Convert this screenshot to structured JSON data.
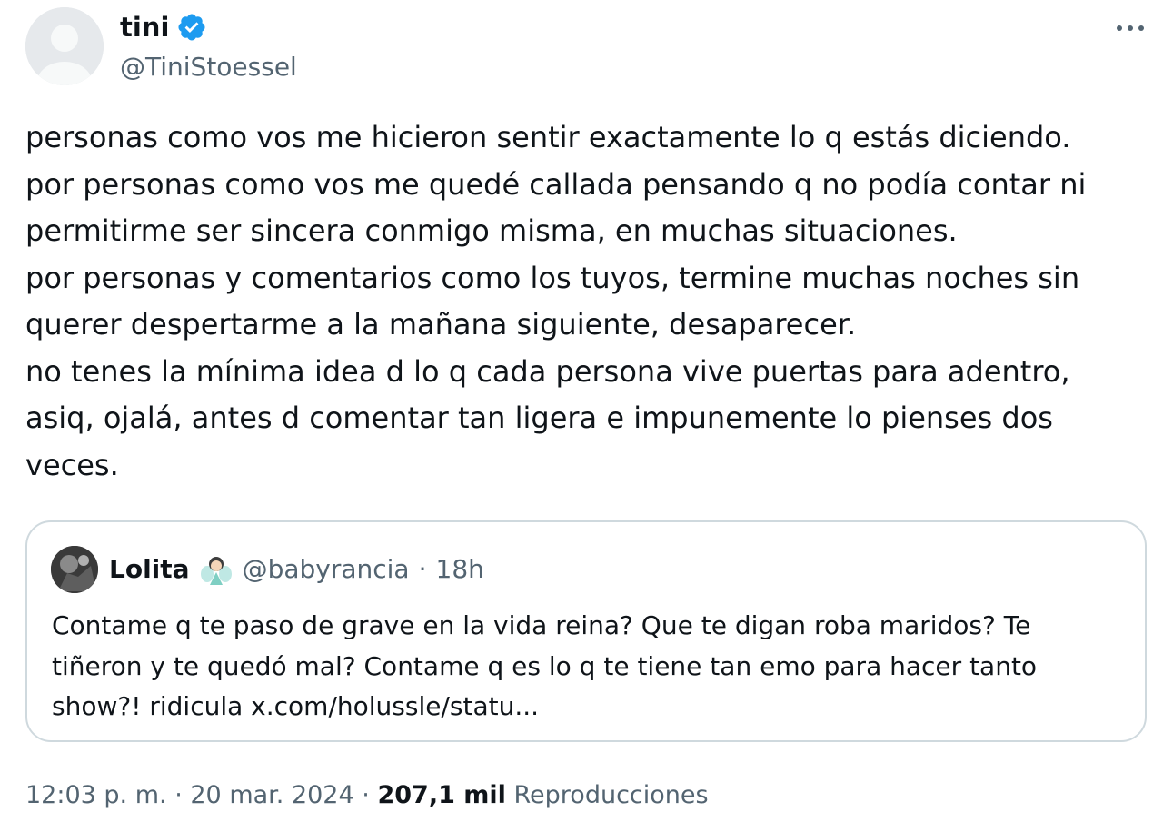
{
  "author": {
    "name": "tini",
    "handle": "@TiniStoessel",
    "verified_color": "#1d9bf0"
  },
  "tweet": {
    "lines": [
      "personas como vos me hicieron sentir exactamente lo q estás diciendo.",
      "por personas como vos me quedé callada pensando q no podía contar ni",
      "permitirme ser sincera conmigo misma, en muchas situaciones.",
      "por personas y comentarios como los tuyos, termine muchas noches sin",
      "querer despertarme a la mañana siguiente, desaparecer.",
      "no tenes la mínima idea d lo q cada persona vive puertas para adentro,",
      "asiq, ojalá, antes d comentar tan ligera e impunemente lo pienses dos",
      "veces."
    ]
  },
  "quote": {
    "name": "Lolita",
    "emoji": "fairy-emoji",
    "handle": "@babyrancia",
    "separator": "·",
    "time": "18h",
    "lines": [
      "Contame q te paso de grave en la vida reina? Que te digan roba maridos? Te",
      "tiñeron y te quedó mal? Contame q es lo q te tiene tan emo para hacer tanto",
      "show?! ridicula x.com/holussle/statu..."
    ]
  },
  "footer": {
    "time": "12:03 p. m.",
    "separator": "·",
    "date": "20 mar. 2024",
    "views_count": "207,1 mil",
    "views_label": "Reproducciones"
  },
  "icons": {
    "more": "more-icon",
    "verified": "verified-icon"
  }
}
